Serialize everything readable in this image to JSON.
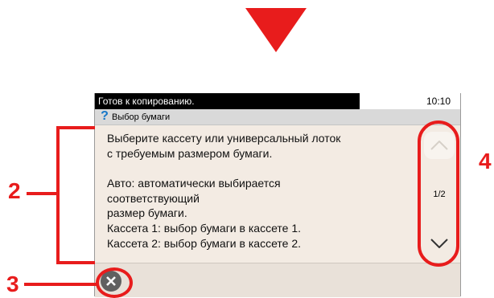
{
  "status": {
    "message": "Готов к копированию.",
    "time": "10:10"
  },
  "title": "Выбор бумаги",
  "message_lines": [
    "Выберите кассету или универсальный лоток",
    "с требуемым размером бумаги.",
    "Авто: автоматически выбирается",
    "соответствующий",
    "размер бумаги.",
    "Кассета 1: выбор бумаги в кассете 1.",
    "Кассета 2: выбор бумаги в кассете 2."
  ],
  "scroll": {
    "page_indicator": "1/2"
  },
  "callouts": {
    "c2": "2",
    "c3": "3",
    "c4": "4"
  },
  "icons": {
    "help": "help-icon",
    "close": "close-icon",
    "scroll_up": "chevron-up-icon",
    "scroll_down": "chevron-down-icon"
  },
  "colors": {
    "annotation": "#e81c1c",
    "help_icon": "#1677c8"
  }
}
